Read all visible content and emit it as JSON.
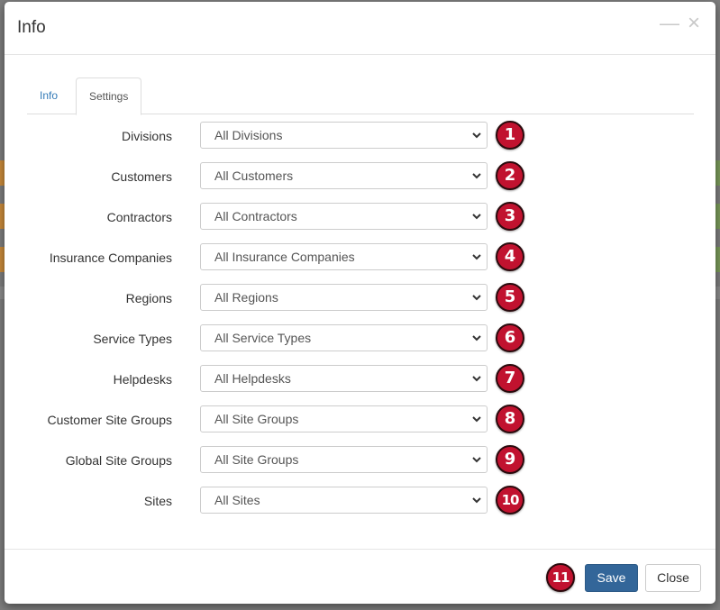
{
  "modal": {
    "title": "Info",
    "minimize_glyph": "—",
    "close_glyph": "×"
  },
  "tabs": [
    {
      "label": "Info",
      "active": false
    },
    {
      "label": "Settings",
      "active": true
    }
  ],
  "fields": [
    {
      "label": "Divisions",
      "value": "All Divisions",
      "badge": "1"
    },
    {
      "label": "Customers",
      "value": "All Customers",
      "badge": "2"
    },
    {
      "label": "Contractors",
      "value": "All Contractors",
      "badge": "3"
    },
    {
      "label": "Insurance Companies",
      "value": "All Insurance Companies",
      "badge": "4"
    },
    {
      "label": "Regions",
      "value": "All Regions",
      "badge": "5"
    },
    {
      "label": "Service Types",
      "value": "All Service Types",
      "badge": "6"
    },
    {
      "label": "Helpdesks",
      "value": "All Helpdesks",
      "badge": "7"
    },
    {
      "label": "Customer Site Groups",
      "value": "All Site Groups",
      "badge": "8"
    },
    {
      "label": "Global Site Groups",
      "value": "All Site Groups",
      "badge": "9"
    },
    {
      "label": "Sites",
      "value": "All Sites",
      "badge": "10"
    }
  ],
  "footer": {
    "save_label": "Save",
    "close_label": "Close",
    "badge": "11"
  },
  "colors": {
    "badge": "#c1122f",
    "primary_button": "#336699",
    "link": "#337ab7"
  },
  "icons": {
    "dropdown": "chevron-down-icon",
    "minimize": "minimize-icon",
    "close": "close-icon"
  }
}
